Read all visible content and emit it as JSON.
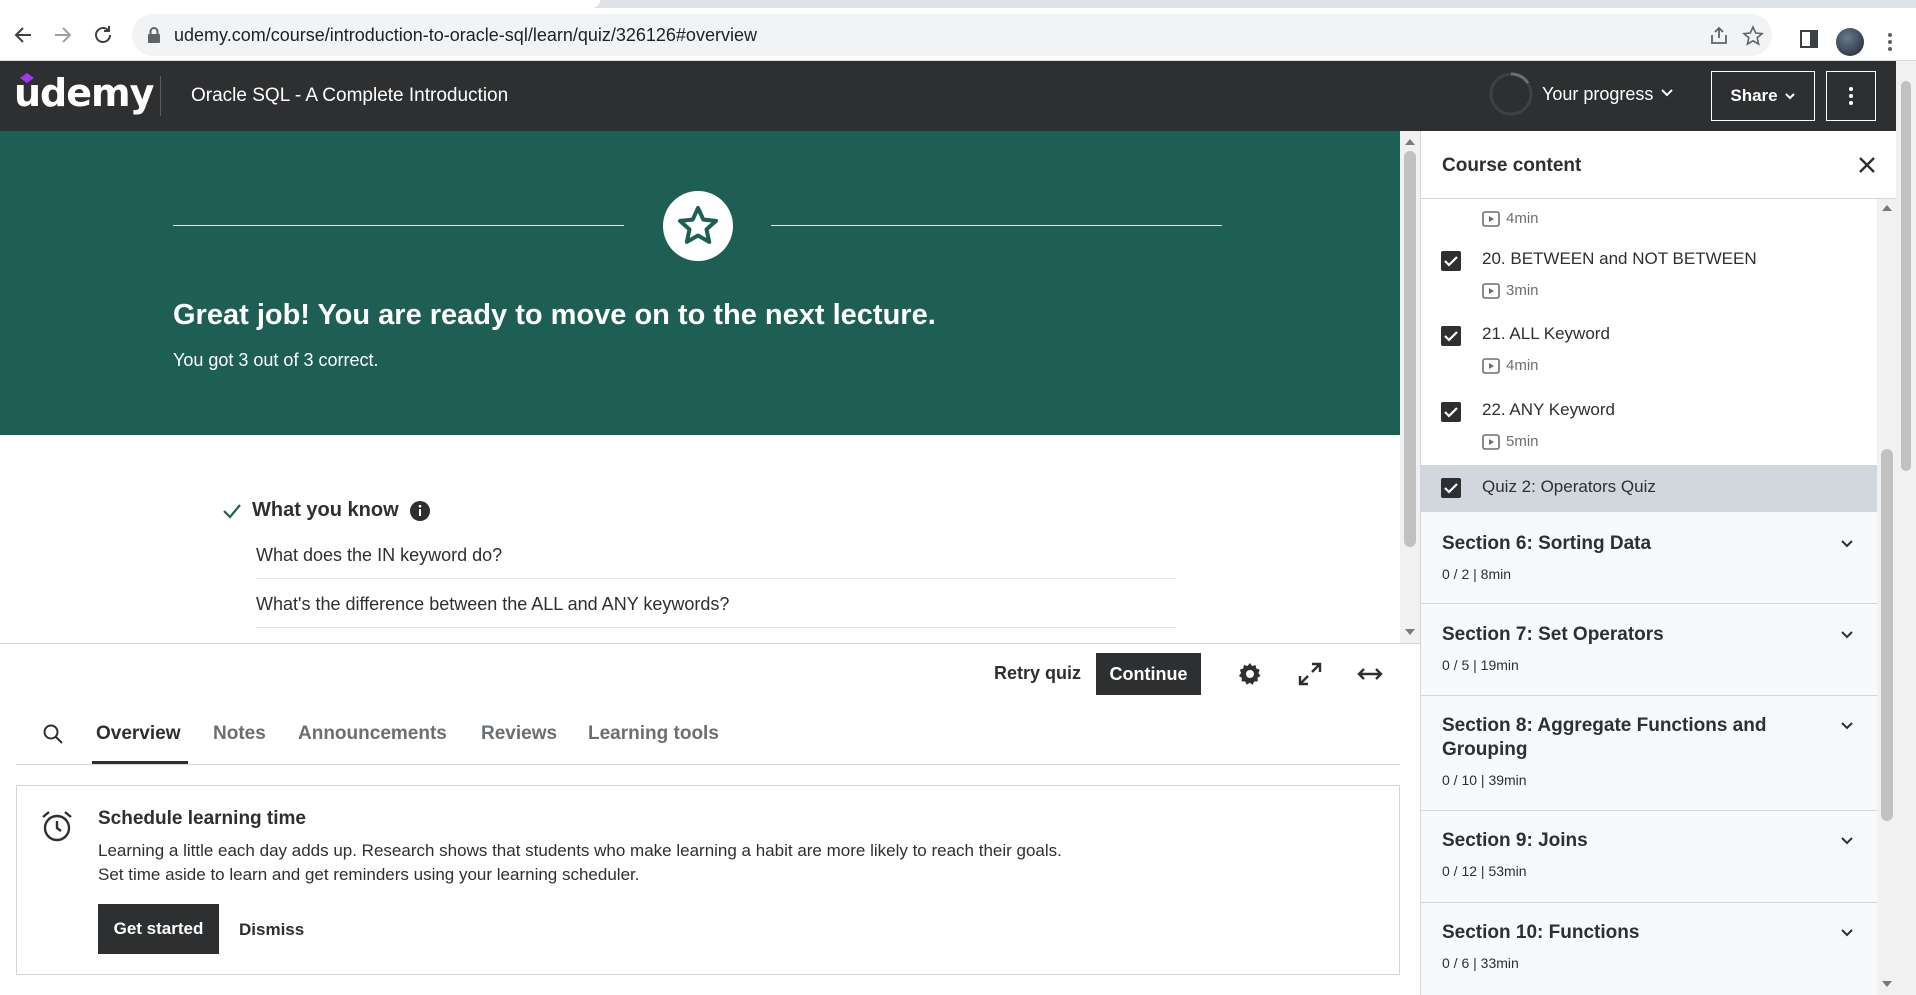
{
  "browser": {
    "url": "udemy.com/course/introduction-to-oracle-sql/learn/quiz/326126#overview"
  },
  "header": {
    "logo": "udemy",
    "course_title": "Oracle SQL - A Complete Introduction",
    "progress_label": "Your progress",
    "share_label": "Share"
  },
  "quiz": {
    "headline": "Great job! You are ready to move on to the next lecture.",
    "score_text": "You got 3 out of 3 correct.",
    "what_you_know_label": "What you know",
    "questions": [
      "What does the IN keyword do?",
      "What's the difference between the ALL and ANY keywords?"
    ],
    "retry_label": "Retry quiz",
    "continue_label": "Continue"
  },
  "tabs": [
    "Overview",
    "Notes",
    "Announcements",
    "Reviews",
    "Learning tools"
  ],
  "schedule": {
    "title": "Schedule learning time",
    "line1": "Learning a little each day adds up. Research shows that students who make learning a habit are more likely to reach their goals.",
    "line2": "Set time aside to learn and get reminders using your learning scheduler.",
    "get_started": "Get started",
    "dismiss": "Dismiss"
  },
  "sidebar": {
    "title": "Course content",
    "top_duration": "4min",
    "lectures": [
      {
        "title": "20. BETWEEN and NOT BETWEEN",
        "duration": "3min",
        "checked": true
      },
      {
        "title": "21. ALL Keyword",
        "duration": "4min",
        "checked": true
      },
      {
        "title": "22. ANY Keyword",
        "duration": "5min",
        "checked": true
      }
    ],
    "active_item": {
      "title": "Quiz 2: Operators Quiz",
      "checked": true
    },
    "sections": [
      {
        "title": "Section 6: Sorting Data",
        "meta": "0 / 2 | 8min"
      },
      {
        "title": "Section 7: Set Operators",
        "meta": "0 / 5 | 19min"
      },
      {
        "title": "Section 8: Aggregate Functions and Grouping",
        "meta": "0 / 10 | 39min"
      },
      {
        "title": "Section 9: Joins",
        "meta": "0 / 12 | 53min"
      },
      {
        "title": "Section 10: Functions",
        "meta": "0 / 6 | 33min"
      }
    ]
  },
  "colors": {
    "banner": "#1e5f55",
    "dark": "#2d2f31",
    "brand_accent": "#a435f0",
    "check_teal": "#1e6055"
  }
}
